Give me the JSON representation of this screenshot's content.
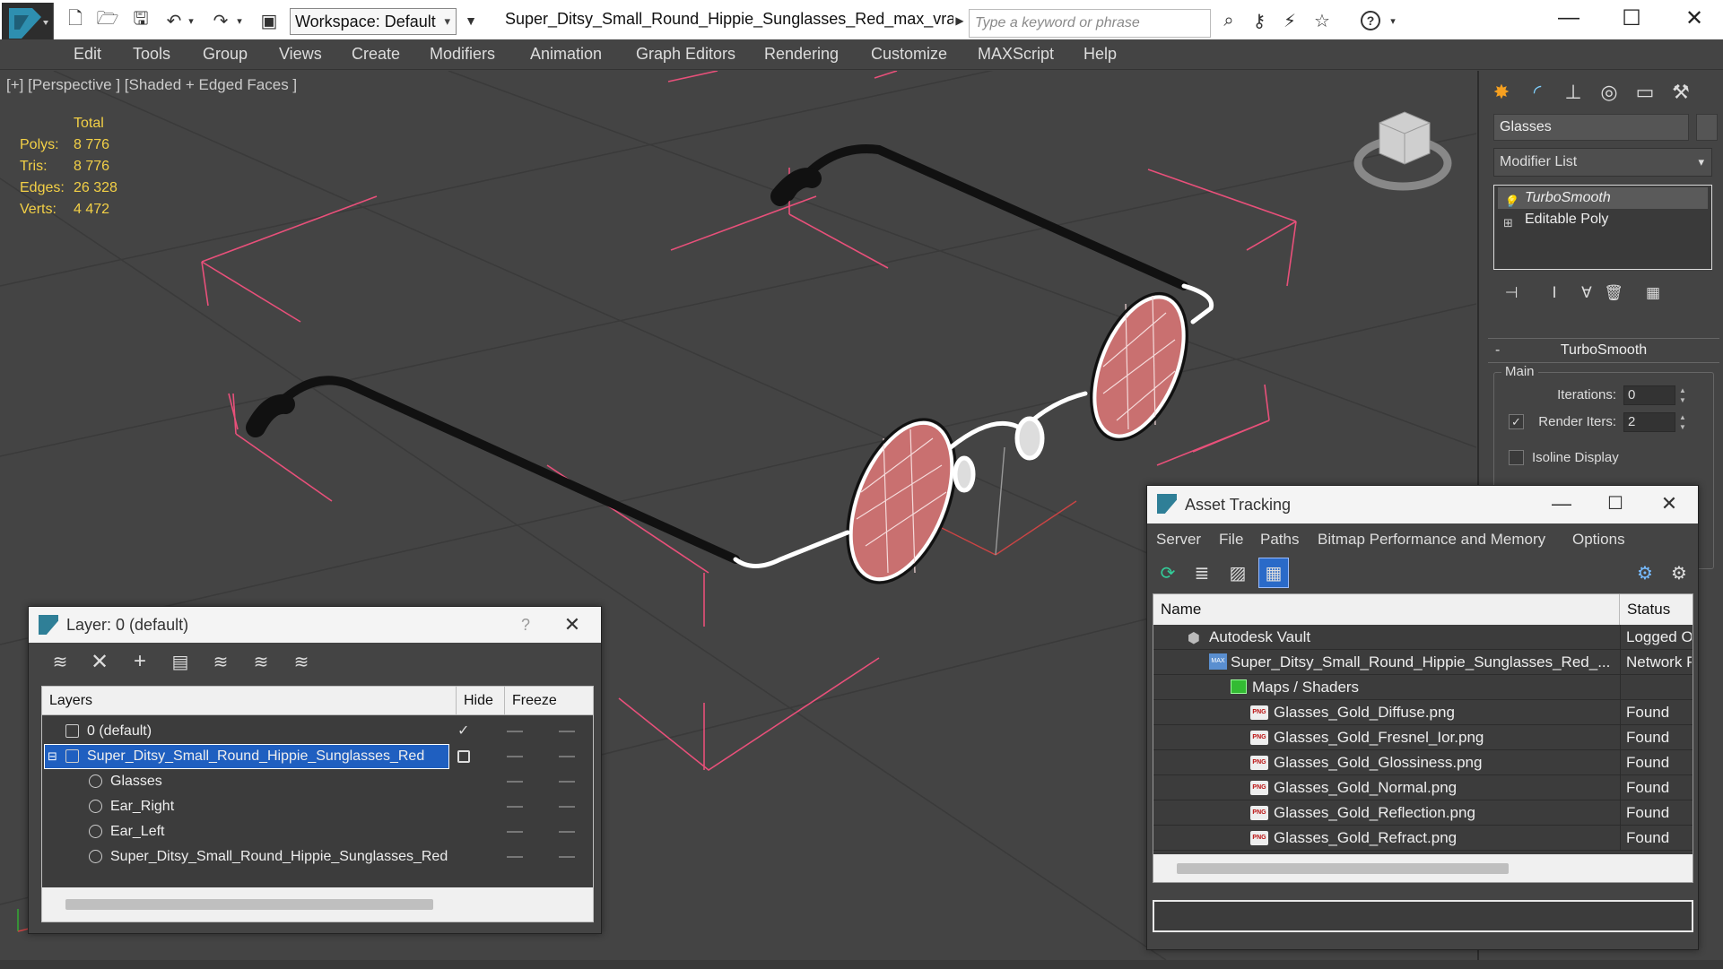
{
  "titlebar": {
    "workspace": "Workspace: Default",
    "document_title": "Super_Ditsy_Small_Round_Hippie_Sunglasses_Red_max_vray....",
    "search_placeholder": "Type a keyword or phrase",
    "help_icon": "question-icon",
    "window_controls": [
      "minimize-icon",
      "maximize-icon",
      "close-icon"
    ]
  },
  "menubar": {
    "items": [
      "Edit",
      "Tools",
      "Group",
      "Views",
      "Create",
      "Modifiers",
      "Animation",
      "Graph Editors",
      "Rendering",
      "Customize",
      "MAXScript",
      "Help"
    ]
  },
  "viewport": {
    "label": "[+] [Perspective ] [Shaded + Edged Faces ]",
    "stats": {
      "header": "Total",
      "rows": [
        {
          "label": "Polys:",
          "value": "8 776"
        },
        {
          "label": "Tris:",
          "value": "8 776"
        },
        {
          "label": "Edges:",
          "value": "26 328"
        },
        {
          "label": "Verts:",
          "value": "4 472"
        }
      ]
    },
    "colors": {
      "stats": "#f3d046",
      "bounding_box": "#e8507a",
      "lens": "#c97070",
      "wire": "#ffffff"
    }
  },
  "command_panel": {
    "tabs": [
      "create-icon",
      "modify-icon",
      "hierarchy-icon",
      "motion-icon",
      "display-icon",
      "utilities-icon"
    ],
    "object_name": "Glasses",
    "modifier_list": "Modifier List",
    "stack": [
      "TurboSmooth",
      "Editable Poly"
    ],
    "turbosmooth": {
      "title": "TurboSmooth",
      "collapse": "-",
      "group": "Main",
      "iterations_label": "Iterations:",
      "iterations_value": "0",
      "render_iters_label": "Render Iters:",
      "render_iters_value": "2",
      "isoline_label": "Isoline Display"
    }
  },
  "layer_dialog": {
    "title": "Layer: 0 (default)",
    "help": "?",
    "columns": [
      "Layers",
      "Hide",
      "Freeze"
    ],
    "rows": [
      {
        "name": "0 (default)",
        "indent": 0,
        "type": "layer",
        "current": true
      },
      {
        "name": "Super_Ditsy_Small_Round_Hippie_Sunglasses_Red",
        "indent": 0,
        "type": "layer",
        "selected": true
      },
      {
        "name": "Glasses",
        "indent": 1,
        "type": "object"
      },
      {
        "name": "Ear_Right",
        "indent": 1,
        "type": "object"
      },
      {
        "name": "Ear_Left",
        "indent": 1,
        "type": "object"
      },
      {
        "name": "Super_Ditsy_Small_Round_Hippie_Sunglasses_Red",
        "indent": 1,
        "type": "object"
      }
    ]
  },
  "asset_dialog": {
    "title": "Asset Tracking",
    "menu": [
      "Server",
      "File",
      "Paths",
      "Bitmap Performance and Memory",
      "Options"
    ],
    "columns": [
      "Name",
      "Status"
    ],
    "rows": [
      {
        "name": "Autodesk Vault",
        "status": "Logged Ou",
        "indent": 1,
        "icon": "vault-icon"
      },
      {
        "name": "Super_Ditsy_Small_Round_Hippie_Sunglasses_Red_...",
        "status": "Network Pa",
        "indent": 2,
        "icon": "max-file-icon"
      },
      {
        "name": "Maps / Shaders",
        "status": "",
        "indent": 3,
        "icon": "maps-folder-icon"
      },
      {
        "name": "Glasses_Gold_Diffuse.png",
        "status": "Found",
        "indent": 4,
        "icon": "png-icon"
      },
      {
        "name": "Glasses_Gold_Fresnel_Ior.png",
        "status": "Found",
        "indent": 4,
        "icon": "png-icon"
      },
      {
        "name": "Glasses_Gold_Glossiness.png",
        "status": "Found",
        "indent": 4,
        "icon": "png-icon"
      },
      {
        "name": "Glasses_Gold_Normal.png",
        "status": "Found",
        "indent": 4,
        "icon": "png-icon"
      },
      {
        "name": "Glasses_Gold_Reflection.png",
        "status": "Found",
        "indent": 4,
        "icon": "png-icon"
      },
      {
        "name": "Glasses_Gold_Refract.png",
        "status": "Found",
        "indent": 4,
        "icon": "png-icon"
      }
    ]
  }
}
